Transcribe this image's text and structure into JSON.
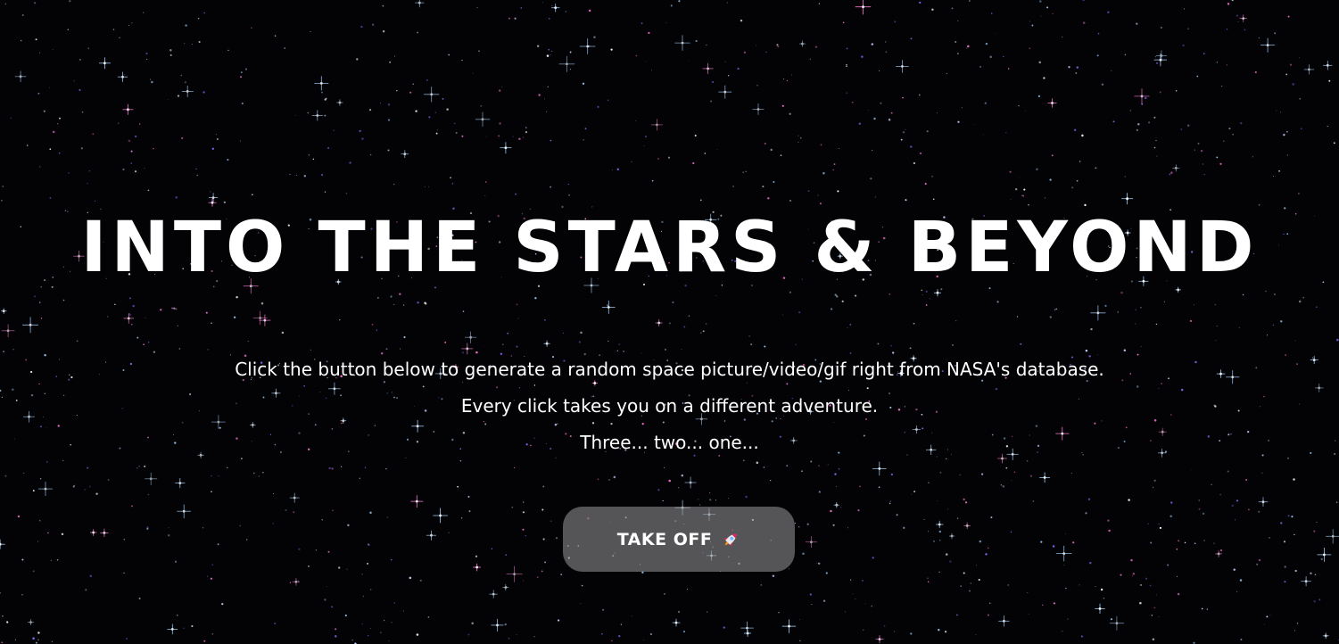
{
  "hero": {
    "title": "INTO THE STARS & BEYOND"
  },
  "intro": {
    "lines": [
      "Click the button below to generate a random space picture/video/gif right from NASA's database.",
      "Every click takes you on a different adventure.",
      "Three... two... one..."
    ]
  },
  "takeoff_button": {
    "label": "TAKE OFF",
    "icon": "rocket-icon"
  },
  "colors": {
    "background": "#030205",
    "text": "#ffffff",
    "button_background": "#5a5a5a",
    "star_blue": "#9fd0ff",
    "star_pink": "#ff7ad9",
    "star_purple": "#8a6bff"
  }
}
